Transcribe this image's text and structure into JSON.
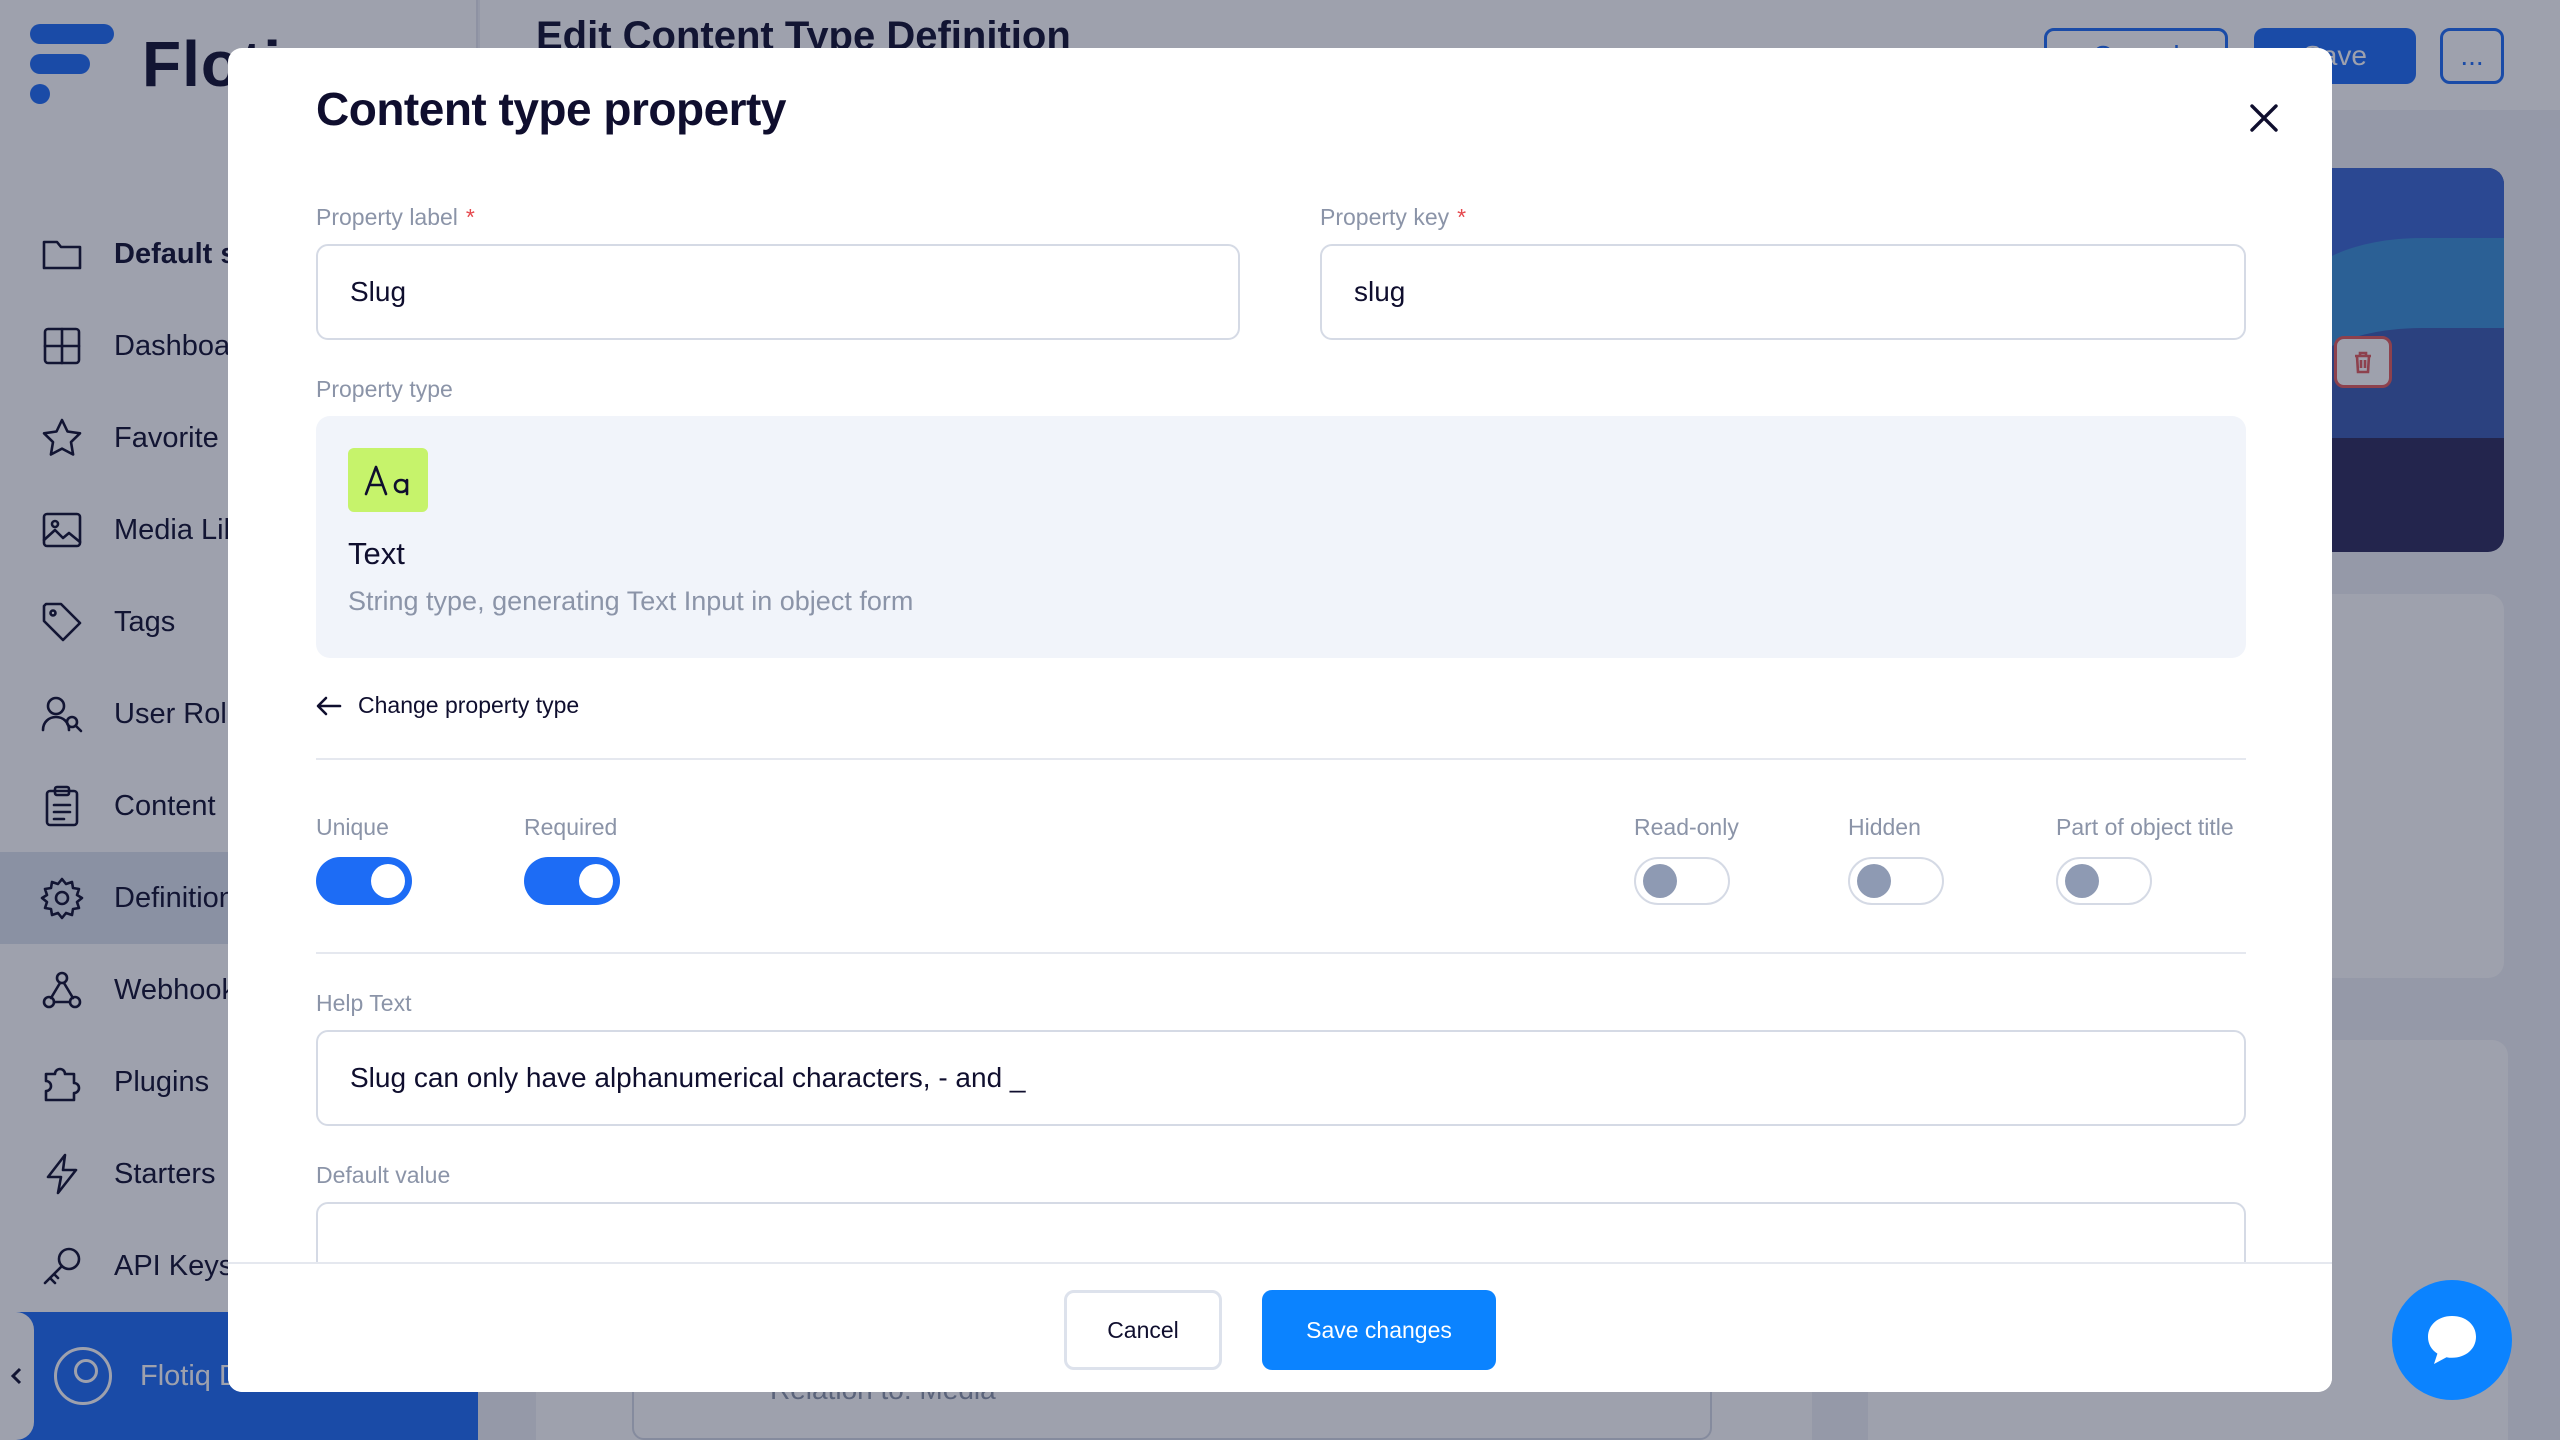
{
  "app": {
    "logo_text": "Flotiq",
    "page_title": "Edit Content Type Definition",
    "header_buttons": {
      "cancel": "Cancel",
      "save": "Save",
      "more": "..."
    },
    "background_field_text": "Relation to: Media",
    "sidebar": {
      "items": [
        {
          "label": "Default space",
          "icon": "folder-icon"
        },
        {
          "label": "Dashboard",
          "icon": "dashboard-icon"
        },
        {
          "label": "Favorite",
          "icon": "star-icon"
        },
        {
          "label": "Media Library",
          "icon": "image-icon"
        },
        {
          "label": "Tags",
          "icon": "tag-icon"
        },
        {
          "label": "User Roles",
          "icon": "users-icon"
        },
        {
          "label": "Content",
          "icon": "clipboard-icon"
        },
        {
          "label": "Definitions",
          "icon": "gear-icon"
        },
        {
          "label": "Webhooks",
          "icon": "webhook-icon"
        },
        {
          "label": "Plugins",
          "icon": "puzzle-icon"
        },
        {
          "label": "Starters",
          "icon": "bolt-icon"
        },
        {
          "label": "API Keys",
          "icon": "key-icon"
        }
      ],
      "user_name": "Flotiq Demo"
    }
  },
  "modal": {
    "title": "Content type property",
    "property_label": {
      "label": "Property label",
      "required_mark": "*",
      "value": "Slug"
    },
    "property_key": {
      "label": "Property key",
      "required_mark": "*",
      "value": "slug"
    },
    "property_type": {
      "label": "Property type",
      "icon": "text-type-icon",
      "name": "Text",
      "description": "String type, generating Text Input in object form"
    },
    "change_type_link": "Change property type",
    "toggles": [
      {
        "label": "Unique",
        "on": true
      },
      {
        "label": "Required",
        "on": true
      },
      {
        "label": "Read-only",
        "on": false
      },
      {
        "label": "Hidden",
        "on": false
      },
      {
        "label": "Part of object title",
        "on": false
      }
    ],
    "help_text": {
      "label": "Help Text",
      "value": "Slug can only have alphanumerical characters, - and _"
    },
    "default_value": {
      "label": "Default value",
      "value": ""
    },
    "footer": {
      "cancel": "Cancel",
      "save": "Save changes"
    }
  },
  "colors": {
    "accent": "#0b83ff",
    "brand": "#1d6cf5",
    "text_type_badge": "#c6f36b",
    "required_mark": "#e5484d"
  }
}
